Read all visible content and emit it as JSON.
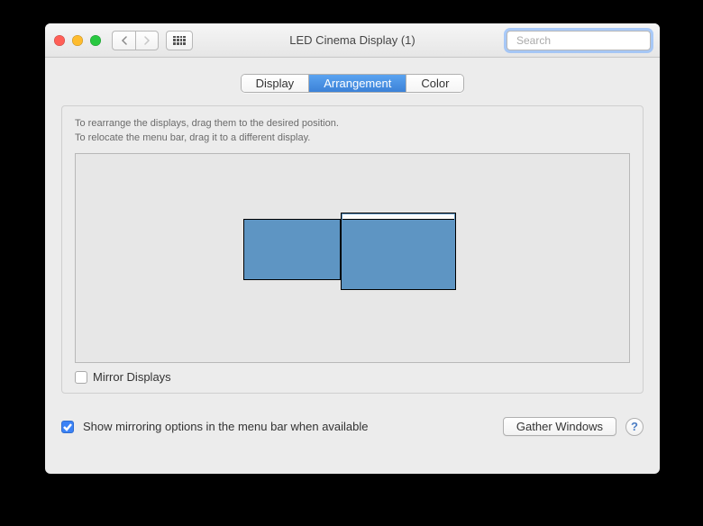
{
  "window": {
    "title": "LED Cinema Display (1)"
  },
  "search": {
    "placeholder": "Search"
  },
  "tabs": {
    "display": "Display",
    "arrangement": "Arrangement",
    "color": "Color"
  },
  "instructions": {
    "line1": "To rearrange the displays, drag them to the desired position.",
    "line2": "To relocate the menu bar, drag it to a different display."
  },
  "mirror_label": "Mirror Displays",
  "footer": {
    "show_mirroring": "Show mirroring options in the menu bar when available",
    "gather": "Gather Windows",
    "help": "?"
  }
}
